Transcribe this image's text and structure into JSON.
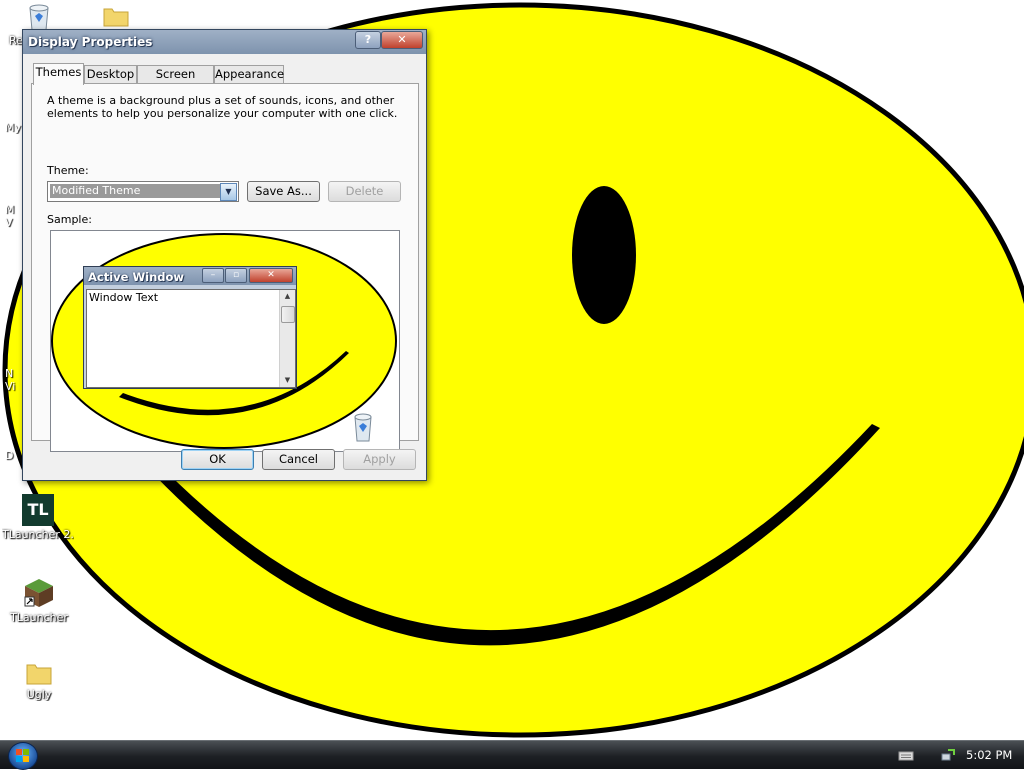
{
  "desktop": {
    "icons": [
      {
        "name": "recycle-bin",
        "label": "Re"
      },
      {
        "name": "folder",
        "label": ""
      },
      {
        "name": "tlauncher-tl",
        "label": "TLauncher 2..."
      },
      {
        "name": "tlauncher-minecraft",
        "label": "TLauncher"
      },
      {
        "name": "ugly-folder",
        "label": "Ugly"
      }
    ],
    "edge_labels": [
      "My",
      "M",
      "V",
      "N",
      "Vi",
      "D"
    ]
  },
  "dialog": {
    "title": "Display Properties",
    "help_label": "?",
    "close_label": "✕",
    "tabs": [
      "Themes",
      "Desktop",
      "Screen Saver",
      "Appearance"
    ],
    "active_tab": "Themes",
    "description": "A theme is a background plus a set of sounds, icons, and other elements to help you personalize your computer with one click.",
    "theme_label": "Theme:",
    "theme_value": "Modified Theme",
    "save_as_label": "Save As...",
    "delete_label": "Delete",
    "sample_label": "Sample:",
    "sample": {
      "window_title": "Active Window",
      "window_text": "Window Text"
    },
    "ok_label": "OK",
    "cancel_label": "Cancel",
    "apply_label": "Apply"
  },
  "taskbar": {
    "clock": "5:02 PM"
  },
  "colors": {
    "wallpaper_yellow": "#ffff00",
    "outline_black": "#000000",
    "dialog_bg": "#f0f0f0",
    "title_blue": "#8fa2bb",
    "close_red": "#c8503c"
  }
}
